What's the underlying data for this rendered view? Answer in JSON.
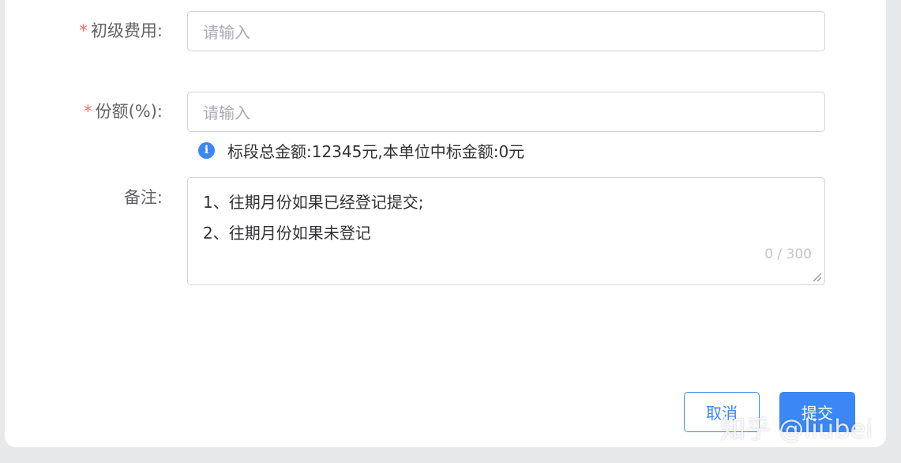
{
  "form": {
    "initial_fee": {
      "required_mark": "*",
      "label": "初级费用:",
      "placeholder": "请输入"
    },
    "share": {
      "required_mark": "*",
      "label": "份额(%):",
      "placeholder": "请输入"
    },
    "tip": {
      "icon": "info-icon",
      "icon_glyph": "i",
      "text": "标段总金额:12345元,本单位中标金额:0元"
    },
    "remarks": {
      "label": "备注:",
      "lines": [
        "1、往期月份如果已经登记提交;",
        "2、往期月份如果未登记"
      ],
      "counter": "0 / 300"
    }
  },
  "actions": {
    "cancel_label": "取消",
    "submit_label": "提交"
  },
  "watermark": "知乎 @liubei",
  "colors": {
    "primary": "#3b87f5",
    "required": "#f56c6c",
    "border": "#cfd3da"
  }
}
